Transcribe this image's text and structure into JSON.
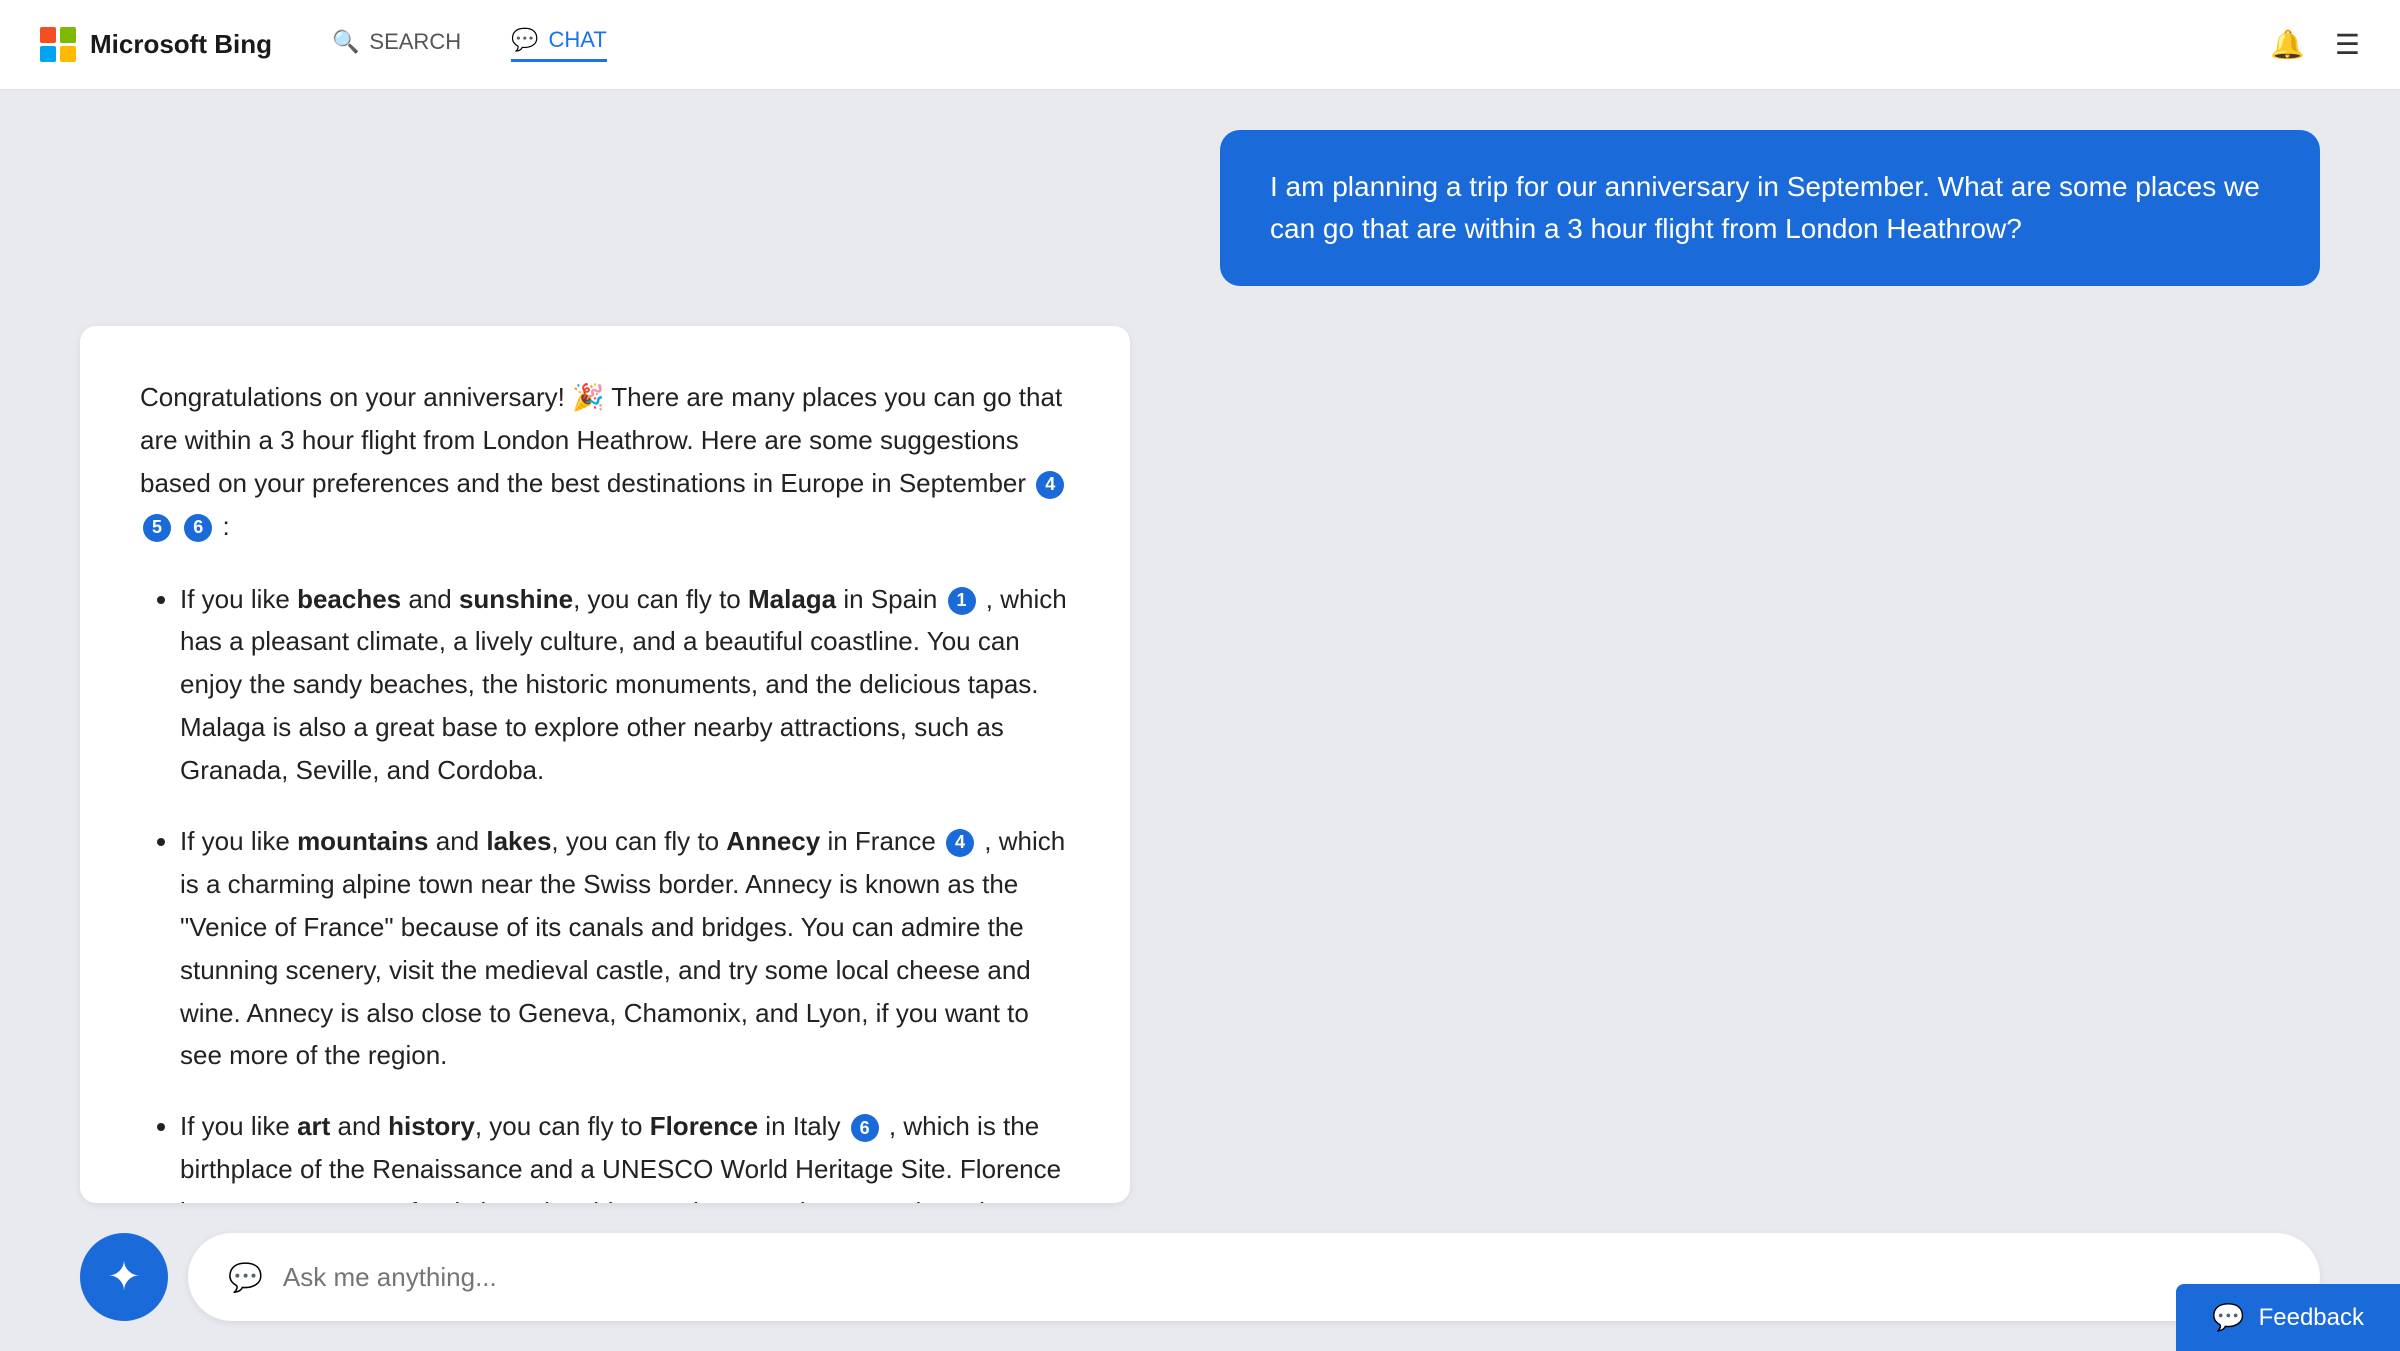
{
  "header": {
    "logo_text": "Microsoft Bing",
    "nav_search_label": "SEARCH",
    "nav_chat_label": "CHAT"
  },
  "user_message": {
    "text": "I am planning a trip for our anniversary in September. What are some places we can go that are within a 3 hour flight from London Heathrow?"
  },
  "ai_response": {
    "intro": "Congratulations on your anniversary! 🎉 There are many places you can go that are within a 3 hour flight from London Heathrow. Here are some suggestions based on your preferences and the best destinations in Europe in September",
    "items": [
      {
        "pref": "beaches",
        "pref2": "sunshine",
        "destination": "Malaga",
        "country": "Spain",
        "citation": "1",
        "description": ", which has a pleasant climate, a lively culture, and a beautiful coastline. You can enjoy the sandy beaches, the historic monuments, and the delicious tapas. Malaga is also a great base to explore other nearby attractions, such as Granada, Seville, and Cordoba."
      },
      {
        "pref": "mountains",
        "pref2": "lakes",
        "destination": "Annecy",
        "country": "France",
        "citation": "4",
        "description": ", which is a charming alpine town near the Swiss border. Annecy is known as the “Venice of France” because of its canals and bridges. You can admire the stunning scenery, visit the medieval castle, and try some local cheese and wine. Annecy is also close to Geneva, Chamonix, and Lyon, if you want to see more of the region."
      },
      {
        "pref": "art",
        "pref2": "history",
        "destination": "Florence",
        "country": "Italy",
        "citation": "6",
        "description": ", which is the birthplace of the Renaissance and a UNESCO World Heritage Site. Florence is a treasure trove of artistic and architectural masterpieces, such as the Duomo, the Uffizi Gallery, and the Ponte Vecchio. You can also explore the Tuscan countryside, taste the famous gelato, and shop for leather goods."
      }
    ],
    "citations_inline": [
      "4",
      "5",
      "6"
    ]
  },
  "input": {
    "placeholder": "Ask me anything..."
  },
  "feedback": {
    "label": "Feedback"
  }
}
